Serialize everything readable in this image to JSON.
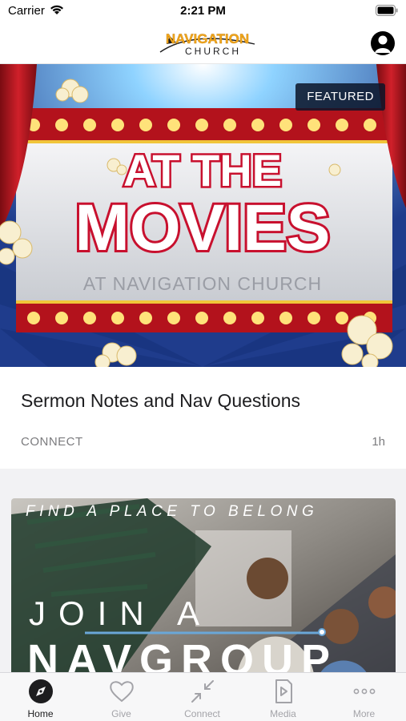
{
  "status_bar": {
    "carrier": "Carrier",
    "time": "2:21 PM"
  },
  "header": {
    "logo_line1": "NAVIGATION",
    "logo_line2": "CHURCH",
    "profile_icon": "person-icon"
  },
  "featured": {
    "badge": "FEATURED",
    "art_line1": "AT THE",
    "art_line2": "MOVIES",
    "art_subtitle": "AT NAVIGATION CHURCH",
    "title": "Sermon Notes and Nav Questions",
    "category": "CONNECT",
    "age": "1h"
  },
  "group_card": {
    "tagline": "FIND A PLACE TO BELONG",
    "line1": "JOIN A",
    "line2": "NAVGROUP"
  },
  "tabs": [
    {
      "label": "Home",
      "icon": "compass-icon",
      "active": true
    },
    {
      "label": "Give",
      "icon": "heart-icon",
      "active": false
    },
    {
      "label": "Connect",
      "icon": "arrows-icon",
      "active": false
    },
    {
      "label": "Media",
      "icon": "media-icon",
      "active": false
    },
    {
      "label": "More",
      "icon": "more-icon",
      "active": false
    }
  ],
  "colors": {
    "accent": "#1d1d1f",
    "inactive": "#a3a3a8",
    "logo_gold": "#f2a81d",
    "movie_red": "#c8102e"
  }
}
